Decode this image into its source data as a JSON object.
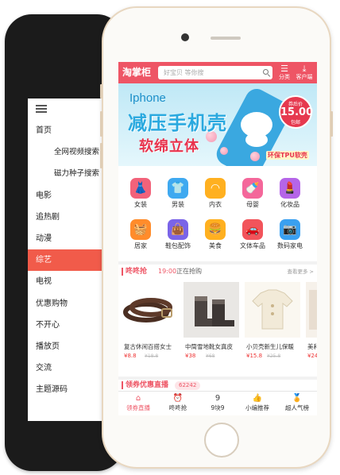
{
  "android": {
    "menu": [
      {
        "label": "首页",
        "sub": false,
        "active": false
      },
      {
        "label": "全网视频搜索",
        "sub": true,
        "active": false
      },
      {
        "label": "磁力种子搜索",
        "sub": true,
        "active": false
      },
      {
        "label": "电影",
        "sub": false,
        "active": false
      },
      {
        "label": "追热剧",
        "sub": false,
        "active": false
      },
      {
        "label": "动漫",
        "sub": false,
        "active": false
      },
      {
        "label": "综艺",
        "sub": false,
        "active": true
      },
      {
        "label": "电视",
        "sub": false,
        "active": false
      },
      {
        "label": "优惠购物",
        "sub": false,
        "active": false
      },
      {
        "label": "不开心",
        "sub": false,
        "active": false
      },
      {
        "label": "播放页",
        "sub": false,
        "active": false
      },
      {
        "label": "交流",
        "sub": false,
        "active": false
      },
      {
        "label": "主题源码",
        "sub": false,
        "active": false
      }
    ]
  },
  "header": {
    "logo": "淘掌柜",
    "search_placeholder": "好宝贝 等你搜",
    "category_label": "分类",
    "client_label": "客户端"
  },
  "banner": {
    "title": "Iphone",
    "line1": "减压手机壳",
    "line2": "软绵立体",
    "badge_top": "券后价",
    "badge_price": "15.00",
    "badge_unit": "包邮",
    "tag": "环保TPU软壳"
  },
  "categories": [
    {
      "label": "女装",
      "icon": "dress-icon",
      "glyph": "👗",
      "color": "#f2627a"
    },
    {
      "label": "男装",
      "icon": "shirt-icon",
      "glyph": "👕",
      "color": "#3fa9f0"
    },
    {
      "label": "内衣",
      "icon": "bra-icon",
      "glyph": "◠",
      "color": "#ffb020"
    },
    {
      "label": "母婴",
      "icon": "bottle-icon",
      "glyph": "🍼",
      "color": "#f4679a"
    },
    {
      "label": "化妆品",
      "icon": "cosmetics-icon",
      "glyph": "💄",
      "color": "#b565e8"
    },
    {
      "label": "居家",
      "icon": "basket-icon",
      "glyph": "🧺",
      "color": "#ff8c2b"
    },
    {
      "label": "鞋包配饰",
      "icon": "bag-icon",
      "glyph": "👜",
      "color": "#7a64e8"
    },
    {
      "label": "美食",
      "icon": "food-icon",
      "glyph": "🍔",
      "color": "#ffb020"
    },
    {
      "label": "文体车品",
      "icon": "car-icon",
      "glyph": "🚗",
      "color": "#f2545b"
    },
    {
      "label": "数码家电",
      "icon": "camera-icon",
      "glyph": "📷",
      "color": "#3aa0f0"
    }
  ],
  "flash_sale": {
    "title": "咚咚抢",
    "time": "19:00",
    "status": "正在抢购",
    "see_more": "查看更多 >",
    "products": [
      {
        "name": "复古休闲百搭女士",
        "price": "¥8.8",
        "orig": "¥18.8",
        "img": "belt"
      },
      {
        "name": "中筒雪地靴女真皮",
        "price": "¥38",
        "orig": "¥68",
        "img": "boots"
      },
      {
        "name": "小贝壳新生儿保暖",
        "price": "¥15.8",
        "orig": "¥25.8",
        "img": "babywear"
      },
      {
        "name": "美利",
        "price": "¥24",
        "orig": "",
        "img": "partial"
      }
    ]
  },
  "live": {
    "title": "领券优惠直播",
    "count": "62242"
  },
  "bottom_nav": [
    {
      "label": "领券直播",
      "icon": "home-icon",
      "glyph": "⌂",
      "active": true
    },
    {
      "label": "咚咚抢",
      "icon": "alarm-icon",
      "glyph": "⏰",
      "active": false
    },
    {
      "label": "9块9",
      "icon": "nine-icon",
      "glyph": "9",
      "active": false
    },
    {
      "label": "小编推荐",
      "icon": "thumb-icon",
      "glyph": "👍",
      "active": false
    },
    {
      "label": "超人气榜",
      "icon": "medal-icon",
      "glyph": "🏅",
      "active": false
    }
  ]
}
